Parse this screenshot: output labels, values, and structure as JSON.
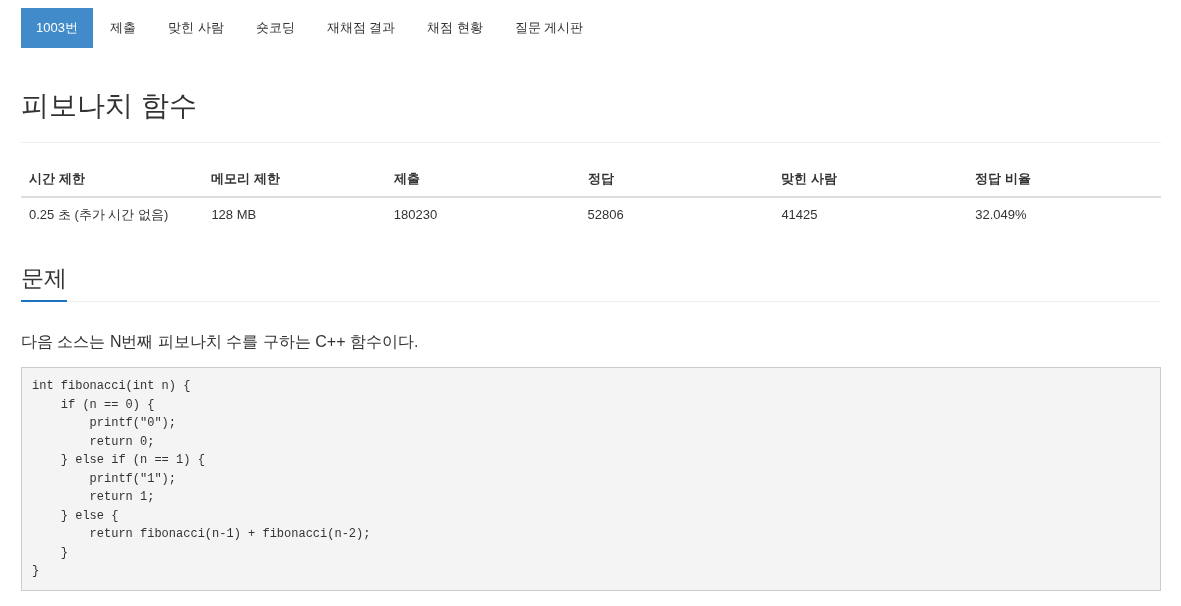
{
  "tabs": [
    {
      "label": "1003번",
      "selected": true
    },
    {
      "label": "제출",
      "selected": false
    },
    {
      "label": "맞힌 사람",
      "selected": false
    },
    {
      "label": "숏코딩",
      "selected": false
    },
    {
      "label": "재채점 결과",
      "selected": false
    },
    {
      "label": "채점 현황",
      "selected": false
    },
    {
      "label": "질문 게시판",
      "selected": false
    }
  ],
  "title": "피보나치 함수",
  "info_table": {
    "columns": [
      "시간 제한",
      "메모리 제한",
      "제출",
      "정답",
      "맞힌 사람",
      "정답 비율"
    ],
    "rows": [
      [
        "0.25 초 (추가 시간 없음)",
        "128 MB",
        "180230",
        "52806",
        "41425",
        "32.049%"
      ]
    ]
  },
  "problem": {
    "heading": "문제",
    "paragraph": "다음 소스는 N번째 피보나치 수를 구하는 C++ 함수이다.",
    "code": "int fibonacci(int n) {\n    if (n == 0) {\n        printf(\"0\");\n        return 0;\n    } else if (n == 1) {\n        printf(\"1\");\n        return 1;\n    } else {\n        return fibonacci(n-1) + fibonacci(n-2);\n    }\n}"
  }
}
